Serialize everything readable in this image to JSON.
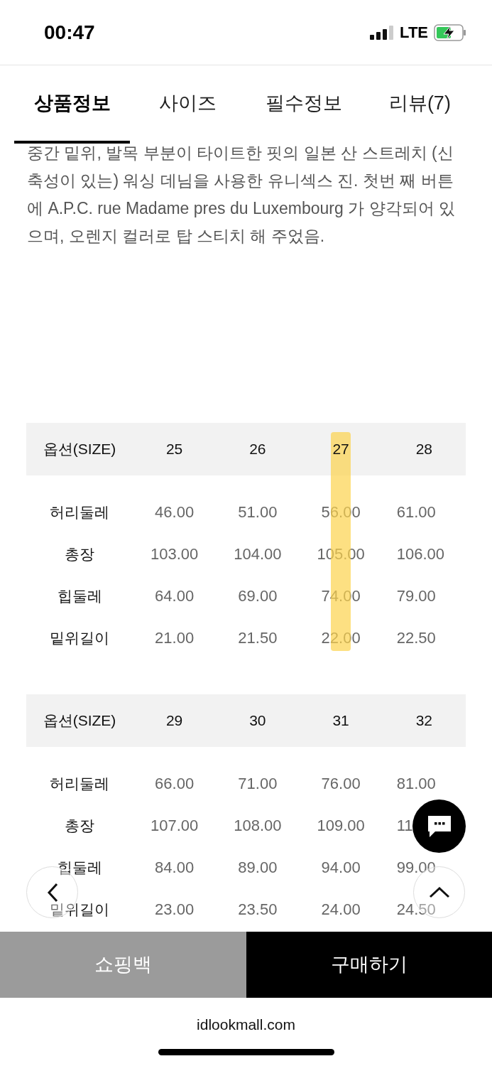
{
  "status_bar": {
    "time": "00:47",
    "network": "LTE"
  },
  "tabs": [
    {
      "label": "상품정보",
      "selected": true
    },
    {
      "label": "사이즈",
      "selected": false
    },
    {
      "label": "필수정보",
      "selected": false
    },
    {
      "label": "리뷰(7)",
      "selected": false
    }
  ],
  "description": "중간 밑위, 발목 부분이 타이트한 핏의 일본 산 스트레치 (신축성이 있는) 워싱 데님을 사용한 유니섹스 진. 첫번 째 버튼에 A.P.C. rue Madame pres du Luxembourg 가 양각되어 있으며, 오렌지 컬러로 탑 스티치 해 주었음.",
  "size_tables": [
    {
      "header": [
        {
          "label": "옵션(SIZE)",
          "highlighted": false
        },
        {
          "label": "25",
          "highlighted": false
        },
        {
          "label": "26",
          "highlighted": false
        },
        {
          "label": "27",
          "highlighted": true
        },
        {
          "label": "28",
          "highlighted": false
        }
      ],
      "rows": [
        [
          "허리둘레",
          "46.00",
          "51.00",
          "56.00",
          "61.00"
        ],
        [
          "총장",
          "103.00",
          "104.00",
          "105.00",
          "106.00"
        ],
        [
          "힙둘레",
          "64.00",
          "69.00",
          "74.00",
          "79.00"
        ],
        [
          "밑위길이",
          "21.00",
          "21.50",
          "22.00",
          "22.50"
        ]
      ]
    },
    {
      "header": [
        {
          "label": "옵션(SIZE)",
          "highlighted": false
        },
        {
          "label": "29",
          "highlighted": false
        },
        {
          "label": "30",
          "highlighted": false
        },
        {
          "label": "31",
          "highlighted": false
        },
        {
          "label": "32",
          "highlighted": false
        }
      ],
      "rows": [
        [
          "허리둘레",
          "66.00",
          "71.00",
          "76.00",
          "81.00"
        ],
        [
          "총장",
          "107.00",
          "108.00",
          "109.00",
          "11"
        ],
        [
          "힙둘레",
          "84.00",
          "89.00",
          "94.00",
          "99.00"
        ],
        [
          "밑위길이",
          "23.00",
          "23.50",
          "24.00",
          "24.50"
        ]
      ]
    }
  ],
  "bottom_buttons": [
    {
      "label": "쇼핑백",
      "kind": "secondary"
    },
    {
      "label": "구매하기",
      "kind": "primary"
    }
  ],
  "url": "idlookmall.com"
}
